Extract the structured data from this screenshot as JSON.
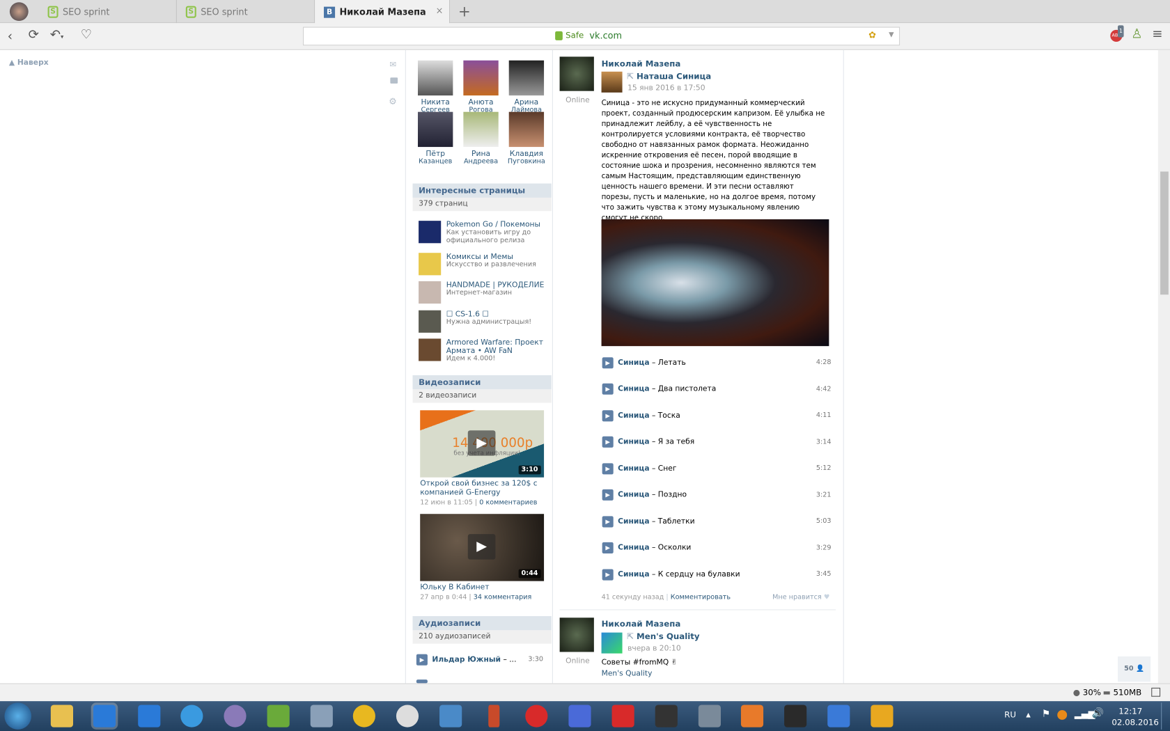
{
  "browser": {
    "tabs": [
      {
        "label": "SEO sprint"
      },
      {
        "label": "SEO sprint"
      },
      {
        "label": "Николай Мазепа",
        "icon": "В"
      }
    ],
    "new_tab": "+",
    "close": "×",
    "safe_label": "Safe",
    "url": "vk.com",
    "abp_badge": "1"
  },
  "page": {
    "back_to_top": "Наверх",
    "friends": [
      {
        "first": "Никита",
        "last": "Сергеев"
      },
      {
        "first": "Анюта",
        "last": "Рогова"
      },
      {
        "first": "Арина",
        "last": "Лаймова"
      },
      {
        "first": "Пётр",
        "last": "Казанцев"
      },
      {
        "first": "Рина",
        "last": "Андреева"
      },
      {
        "first": "Клавдия",
        "last": "Пуговкина"
      }
    ],
    "interesting": {
      "title": "Интересные страницы",
      "count": "379 страниц",
      "items": [
        {
          "title": "Pokemon Go / Покемоны",
          "sub": "Как установить игру до официального релиза"
        },
        {
          "title": "Комиксы и Мемы",
          "sub": "Искусство и развлечения"
        },
        {
          "title": "HANDMADE | РУКОДЕЛИЕ",
          "sub": "Интернет-магазин"
        },
        {
          "title": "☐ CS-1.6 ☐",
          "sub": "Нужна администрацыя!"
        },
        {
          "title": "Armored Warfare: Проект Армата • AW FaN",
          "sub": "Идем к 4.000!"
        }
      ]
    },
    "videos": {
      "title": "Видеозаписи",
      "count": "2 видеозаписи",
      "items": [
        {
          "title": "Открой свой бизнес за 120$ с компанией G-Energy",
          "date": "12 июн в 11:05",
          "comments": "0 комментариев",
          "duration": "3:10",
          "overlay": "14 400 000р",
          "overlay2": "без учета инфляции!"
        },
        {
          "title": "Юльку В Кабинет",
          "date": "27 апр в 0:44",
          "comments": "34 комментария",
          "duration": "0:44"
        }
      ]
    },
    "audio": {
      "title": "Аудиозаписи",
      "count": "210 аудиозаписей",
      "items": [
        {
          "artist": "Ильдар Южный",
          "title": "...",
          "duration": "3:30"
        }
      ]
    },
    "posts": [
      {
        "author": "Николай Мазепа",
        "status": "Online",
        "repost_from": "Наташа Синица",
        "date": "15 янв 2016 в 17:50",
        "text": "Синица - это не искусно придуманный коммерческий проект, созданный продюсерским капризом. Её улыбка не принадлежит лейблу, а её чувственность не контролируется условиями контракта, её творчество свободно от навязанных рамок формата. Неожиданно искренние откровения её песен, порой вводящие в состояние шока и прозрения, несомненно являются тем самым Настоящим, представляющим единственную ценность нашего времени. И эти песни оставляют порезы, пусть и маленькие, но на долгое время, потому что зажить чувства к этому музыкальному явлению смогут не скоро.",
        "tracks": [
          {
            "artist": "Синица",
            "title": "Летать",
            "duration": "4:28"
          },
          {
            "artist": "Синица",
            "title": "Два пистолета",
            "duration": "4:42"
          },
          {
            "artist": "Синица",
            "title": "Тоска",
            "duration": "4:11"
          },
          {
            "artist": "Синица",
            "title": "Я за тебя",
            "duration": "3:14"
          },
          {
            "artist": "Синица",
            "title": "Снег",
            "duration": "5:12"
          },
          {
            "artist": "Синица",
            "title": "Поздно",
            "duration": "3:21"
          },
          {
            "artist": "Синица",
            "title": "Таблетки",
            "duration": "5:03"
          },
          {
            "artist": "Синица",
            "title": "Осколки",
            "duration": "3:29"
          },
          {
            "artist": "Синица",
            "title": "К сердцу на булавки",
            "duration": "3:45"
          }
        ],
        "time_ago": "41 секунду назад",
        "comment": "Комментировать",
        "like": "Мне нравится"
      },
      {
        "author": "Николай Мазепа",
        "status": "Online",
        "repost_from": "Men's Quality",
        "date": "вчера в 20:10",
        "text": "Советы #fromMQ ✌",
        "link": "Men's Quality"
      }
    ],
    "online_count": "50"
  },
  "statusbar": {
    "cpu": "30%",
    "mem": "510MB"
  },
  "taskbar": {
    "lang": "RU",
    "time": "12:17",
    "date": "02.08.2016"
  }
}
